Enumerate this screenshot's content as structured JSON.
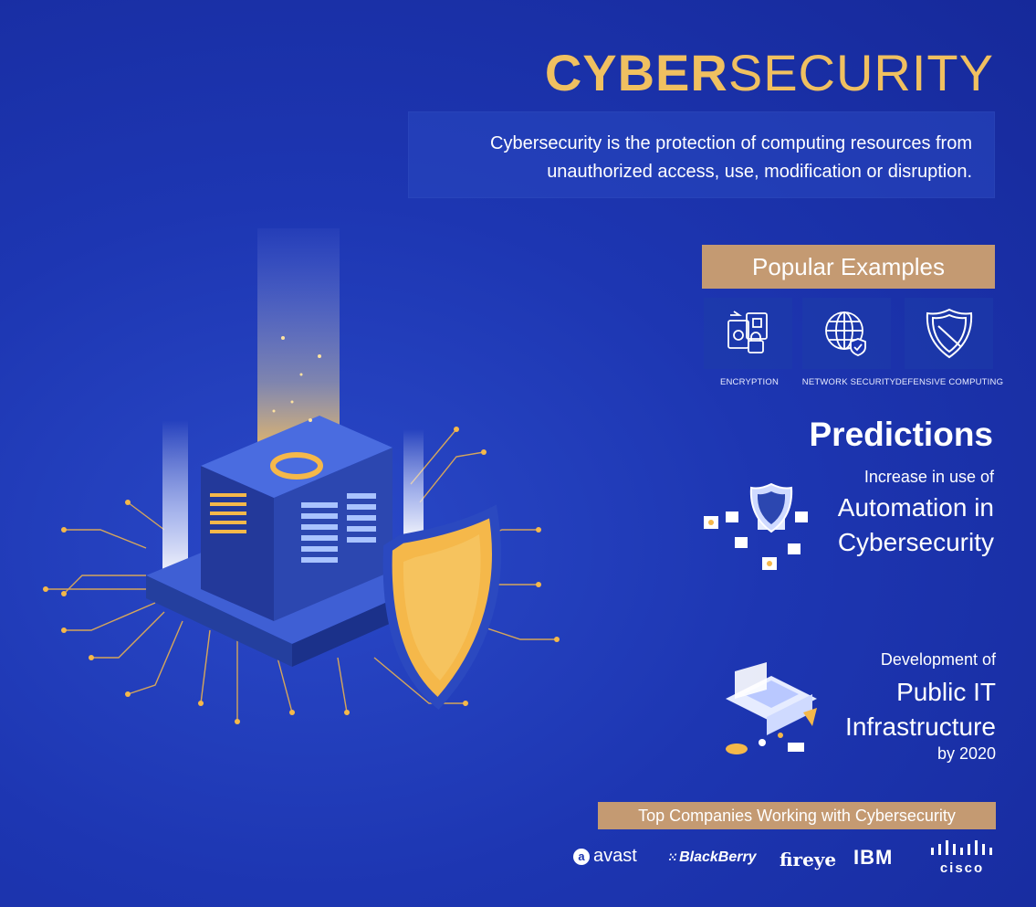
{
  "title": {
    "bold": "CYBER",
    "light": "SECURITY"
  },
  "definition": "Cybersecurity is the protection of computing resources from unauthorized access, use, modification or disruption.",
  "examples": {
    "heading": "Popular Examples",
    "items": [
      {
        "label": "ENCRYPTION",
        "icon": "encryption-icon"
      },
      {
        "label": "NETWORK SECURITY",
        "icon": "network-security-icon"
      },
      {
        "label": "DEFENSIVE COMPUTING",
        "icon": "shield-icon"
      }
    ]
  },
  "predictions": {
    "heading": "Predictions",
    "items": [
      {
        "intro": "Increase in use of",
        "main": [
          "Automation in",
          "Cybersecurity"
        ]
      },
      {
        "intro": "Development of",
        "main": [
          "Public IT",
          "Infrastructure"
        ],
        "tail": "by 2020"
      }
    ]
  },
  "companies": {
    "heading": "Top Companies Working with Cybersecurity",
    "logos": [
      "avast",
      "BlackBerry",
      "fireye",
      "IBM",
      "cisco"
    ]
  },
  "colors": {
    "background": "#1d36b2",
    "gold": "#f0c060",
    "accent_box": "#c49a72",
    "illustration_gold": "#f5b84a"
  }
}
